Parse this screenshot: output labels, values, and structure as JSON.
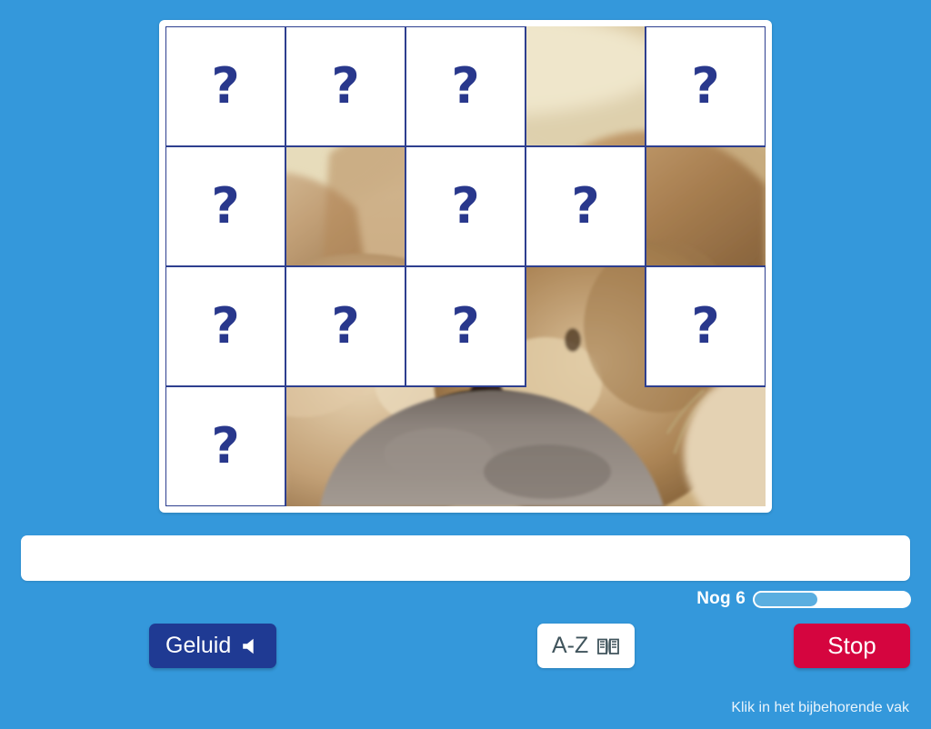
{
  "app": {
    "background_color": "#3498db",
    "accent_navy": "#29388c",
    "accent_red": "#d5053f",
    "tile_border_color": "#2e3f8f"
  },
  "puzzle": {
    "name": "hidden-picture-grid",
    "columns": 5,
    "rows": 4,
    "cover_symbol": "?",
    "image_subject": "two lions nuzzling over a grey rock",
    "tiles": [
      {
        "row": 1,
        "col": 1,
        "state": "covered",
        "label": "?"
      },
      {
        "row": 1,
        "col": 2,
        "state": "covered",
        "label": "?"
      },
      {
        "row": 1,
        "col": 3,
        "state": "covered",
        "label": "?"
      },
      {
        "row": 1,
        "col": 4,
        "state": "revealed",
        "label": ""
      },
      {
        "row": 1,
        "col": 5,
        "state": "covered",
        "label": "?"
      },
      {
        "row": 2,
        "col": 1,
        "state": "covered",
        "label": "?"
      },
      {
        "row": 2,
        "col": 2,
        "state": "revealed",
        "label": ""
      },
      {
        "row": 2,
        "col": 3,
        "state": "covered",
        "label": "?"
      },
      {
        "row": 2,
        "col": 4,
        "state": "covered",
        "label": "?"
      },
      {
        "row": 2,
        "col": 5,
        "state": "revealed",
        "label": ""
      },
      {
        "row": 3,
        "col": 1,
        "state": "covered",
        "label": "?"
      },
      {
        "row": 3,
        "col": 2,
        "state": "covered",
        "label": "?"
      },
      {
        "row": 3,
        "col": 3,
        "state": "covered",
        "label": "?"
      },
      {
        "row": 3,
        "col": 4,
        "state": "revealed",
        "label": ""
      },
      {
        "row": 3,
        "col": 5,
        "state": "covered",
        "label": "?"
      },
      {
        "row": 4,
        "col": 1,
        "state": "covered",
        "label": "?"
      },
      {
        "row": 4,
        "col": 2,
        "state": "revealed",
        "label": ""
      },
      {
        "row": 4,
        "col": 3,
        "state": "revealed",
        "label": ""
      },
      {
        "row": 4,
        "col": 4,
        "state": "revealed",
        "label": ""
      },
      {
        "row": 4,
        "col": 5,
        "state": "revealed",
        "label": ""
      }
    ]
  },
  "answer_field": {
    "value": "",
    "placeholder": ""
  },
  "progress": {
    "label": "Nog 6",
    "remaining": 6,
    "percent": 42,
    "fill_color": "#5aaee0"
  },
  "controls": {
    "sound_label": "Geluid",
    "sound_icon": "speaker-icon",
    "az_label": "A-Z",
    "az_icon": "open-book-icon",
    "stop_label": "Stop"
  },
  "hint": {
    "text": "Klik in het bijbehorende vak"
  }
}
